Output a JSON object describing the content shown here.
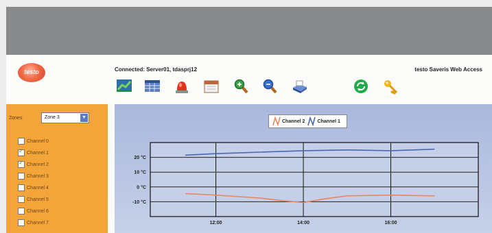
{
  "header": {
    "logo_text": "testo",
    "connected": "Connected: Server01, tdasprj12",
    "brand": "testo Saveris Web Access"
  },
  "toolbar": {
    "icons": [
      "chart-view-icon",
      "table-view-icon",
      "alarm-icon",
      "calendar-icon",
      "zoom-in-icon",
      "zoom-out-icon",
      "print-icon",
      "refresh-icon",
      "key-icon"
    ]
  },
  "sidebar": {
    "zones_label": "Zones",
    "zone_selected": "Zone 3",
    "channels": [
      {
        "label": "Channel 0",
        "checked": false
      },
      {
        "label": "Channel 1",
        "checked": true
      },
      {
        "label": "Channel 2",
        "checked": true
      },
      {
        "label": "Channel 3",
        "checked": false
      },
      {
        "label": "Channel 4",
        "checked": false
      },
      {
        "label": "Channel 5",
        "checked": false
      },
      {
        "label": "Channel 6",
        "checked": false
      },
      {
        "label": "Channel 7",
        "checked": false
      }
    ]
  },
  "colors": {
    "sidebar": "#f4a53a",
    "channel_1": "#4a67b0",
    "channel_2": "#e8865f"
  },
  "chart_data": {
    "type": "line",
    "legend": [
      "Channel 2",
      "Channel 1"
    ],
    "ytick_labels": [
      "20 °C",
      "10 °C",
      "0 °C",
      "-10 °C"
    ],
    "ytick_values": [
      20,
      10,
      0,
      -10
    ],
    "xtick_labels": [
      "12:00",
      "14:00",
      "16:00"
    ],
    "xtick_values": [
      12,
      14,
      16
    ],
    "xlim": [
      10.5,
      18
    ],
    "ylim": [
      -20,
      30
    ],
    "grid": true,
    "series": [
      {
        "name": "Channel 1",
        "color": "#4a67b0",
        "x": [
          11.3,
          12,
          13,
          14,
          15,
          16,
          17
        ],
        "y": [
          21.5,
          22.5,
          23.5,
          24.5,
          25,
          24.5,
          25.5
        ]
      },
      {
        "name": "Channel 2",
        "color": "#e8865f",
        "x": [
          11.3,
          12,
          13,
          13.6,
          14,
          14.5,
          15,
          16,
          17
        ],
        "y": [
          -4.5,
          -5.5,
          -7.5,
          -9.5,
          -10.5,
          -8,
          -6,
          -5.5,
          -6
        ]
      }
    ]
  }
}
